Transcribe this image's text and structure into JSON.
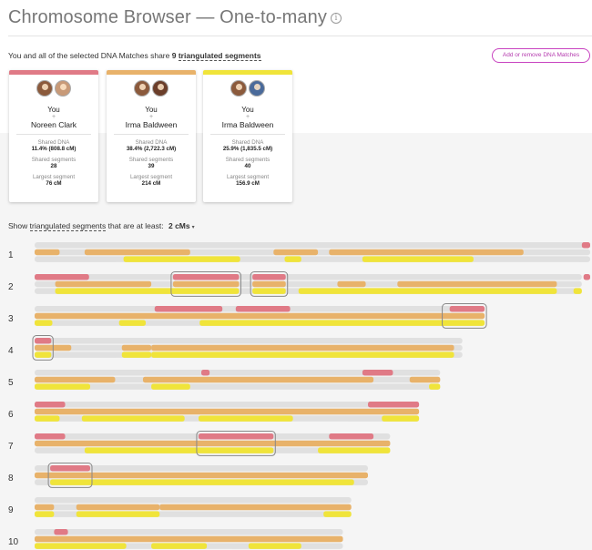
{
  "page": {
    "title": "Chromosome Browser — One-to-many",
    "info_icon": "info-icon",
    "summary_prefix": "You and all of the selected DNA Matches share",
    "summary_count": "9",
    "summary_link": "triangulated segments",
    "add_button": "Add or remove DNA Matches",
    "threshold_prefix": "Show",
    "threshold_link": "triangulated segments",
    "threshold_suffix": "that are at least:",
    "threshold_value": "2 cMs",
    "threshold_caret": "▾"
  },
  "colors": {
    "red": "#e07a86",
    "orange": "#e8b26a",
    "yellow": "#f0e43a",
    "gray": "#e0e0e0"
  },
  "cards": [
    {
      "you": "You",
      "plus": "+",
      "match": "Noreen Clark",
      "shared_dna_label": "Shared DNA",
      "shared_dna": "11.4% (808.8 cM)",
      "segments_label": "Shared segments",
      "segments": "28",
      "largest_label": "Largest segment",
      "largest": "76 cM",
      "color": "#e07a86"
    },
    {
      "you": "You",
      "plus": "+",
      "match": "Irma Baldween",
      "shared_dna_label": "Shared DNA",
      "shared_dna": "38.4% (2,722.3 cM)",
      "segments_label": "Shared segments",
      "segments": "39",
      "largest_label": "Largest segment",
      "largest": "214 cM",
      "color": "#e8b26a"
    },
    {
      "you": "You",
      "plus": "+",
      "match": "Irma Baldween",
      "shared_dna_label": "Shared DNA",
      "shared_dna": "25.9% (1,835.5 cM)",
      "segments_label": "Shared segments",
      "segments": "40",
      "largest_label": "Largest segment",
      "largest": "156.9 cM",
      "color": "#f0e43a"
    }
  ],
  "chromosomes": [
    {
      "label": "1",
      "length": 1.0,
      "red": [
        [
          0.985,
          1.0
        ]
      ],
      "orange": [
        [
          0.0,
          0.045
        ],
        [
          0.09,
          0.28
        ],
        [
          0.43,
          0.51
        ],
        [
          0.53,
          0.88
        ]
      ],
      "yellow": [
        [
          0.16,
          0.37
        ],
        [
          0.45,
          0.48
        ],
        [
          0.59,
          0.79
        ]
      ],
      "triangulated": []
    },
    {
      "label": "2",
      "length": 0.985,
      "red": [
        [
          0.0,
          0.098
        ],
        [
          0.249,
          0.368
        ],
        [
          0.392,
          0.452
        ],
        [
          0.988,
          1.0
        ]
      ],
      "orange": [
        [
          0.037,
          0.21
        ],
        [
          0.249,
          0.368
        ],
        [
          0.392,
          0.452
        ],
        [
          0.545,
          0.596
        ],
        [
          0.653,
          0.94
        ]
      ],
      "yellow": [
        [
          0.037,
          0.368
        ],
        [
          0.392,
          0.452
        ],
        [
          0.475,
          0.94
        ],
        [
          0.97,
          0.985
        ]
      ],
      "triangulated": [
        [
          0.249,
          0.368
        ],
        [
          0.392,
          0.452
        ]
      ]
    },
    {
      "label": "3",
      "length": 0.81,
      "red": [
        [
          0.216,
          0.338
        ],
        [
          0.362,
          0.46
        ],
        [
          0.747,
          0.81
        ]
      ],
      "orange": [
        [
          0.0,
          0.81
        ]
      ],
      "yellow": [
        [
          0.0,
          0.032
        ],
        [
          0.152,
          0.2
        ],
        [
          0.297,
          0.81
        ]
      ],
      "triangulated": [
        [
          0.737,
          0.81
        ]
      ]
    },
    {
      "label": "4",
      "length": 0.77,
      "red": [
        [
          0.0,
          0.03
        ]
      ],
      "orange": [
        [
          0.0,
          0.066
        ],
        [
          0.157,
          0.21
        ],
        [
          0.21,
          0.755
        ]
      ],
      "yellow": [
        [
          0.0,
          0.03
        ],
        [
          0.157,
          0.21
        ],
        [
          0.21,
          0.755
        ]
      ],
      "triangulated": [
        [
          0.0,
          0.03
        ]
      ]
    },
    {
      "label": "5",
      "length": 0.73,
      "red": [
        [
          0.3,
          0.315
        ],
        [
          0.59,
          0.645
        ]
      ],
      "orange": [
        [
          0.0,
          0.145
        ],
        [
          0.195,
          0.61
        ],
        [
          0.675,
          0.73
        ]
      ],
      "yellow": [
        [
          0.0,
          0.1
        ],
        [
          0.21,
          0.28
        ],
        [
          0.71,
          0.73
        ]
      ],
      "triangulated": []
    },
    {
      "label": "6",
      "length": 0.692,
      "red": [
        [
          0.0,
          0.055
        ],
        [
          0.6,
          0.692
        ]
      ],
      "orange": [
        [
          0.0,
          0.692
        ]
      ],
      "yellow": [
        [
          0.0,
          0.045
        ],
        [
          0.085,
          0.27
        ],
        [
          0.295,
          0.465
        ],
        [
          0.625,
          0.692
        ]
      ],
      "triangulated": []
    },
    {
      "label": "7",
      "length": 0.64,
      "red": [
        [
          0.0,
          0.055
        ],
        [
          0.295,
          0.43
        ],
        [
          0.53,
          0.61
        ]
      ],
      "orange": [
        [
          0.0,
          0.64
        ]
      ],
      "yellow": [
        [
          0.09,
          0.43
        ],
        [
          0.51,
          0.64
        ]
      ],
      "triangulated": [
        [
          0.295,
          0.43
        ]
      ]
    },
    {
      "label": "8",
      "length": 0.6,
      "red": [
        [
          0.028,
          0.1
        ]
      ],
      "orange": [
        [
          0.0,
          0.6
        ]
      ],
      "yellow": [
        [
          0.028,
          0.575
        ]
      ],
      "triangulated": [
        [
          0.028,
          0.1
        ]
      ]
    },
    {
      "label": "9",
      "length": 0.57,
      "red": [],
      "orange": [
        [
          0.0,
          0.035
        ],
        [
          0.075,
          0.225
        ],
        [
          0.225,
          0.57
        ]
      ],
      "yellow": [
        [
          0.0,
          0.035
        ],
        [
          0.075,
          0.225
        ],
        [
          0.52,
          0.57
        ]
      ],
      "triangulated": []
    },
    {
      "label": "10",
      "length": 0.555,
      "red": [
        [
          0.035,
          0.06
        ]
      ],
      "orange": [
        [
          0.0,
          0.555
        ]
      ],
      "yellow": [
        [
          0.0,
          0.165
        ],
        [
          0.21,
          0.31
        ],
        [
          0.385,
          0.48
        ]
      ],
      "triangulated": []
    }
  ]
}
